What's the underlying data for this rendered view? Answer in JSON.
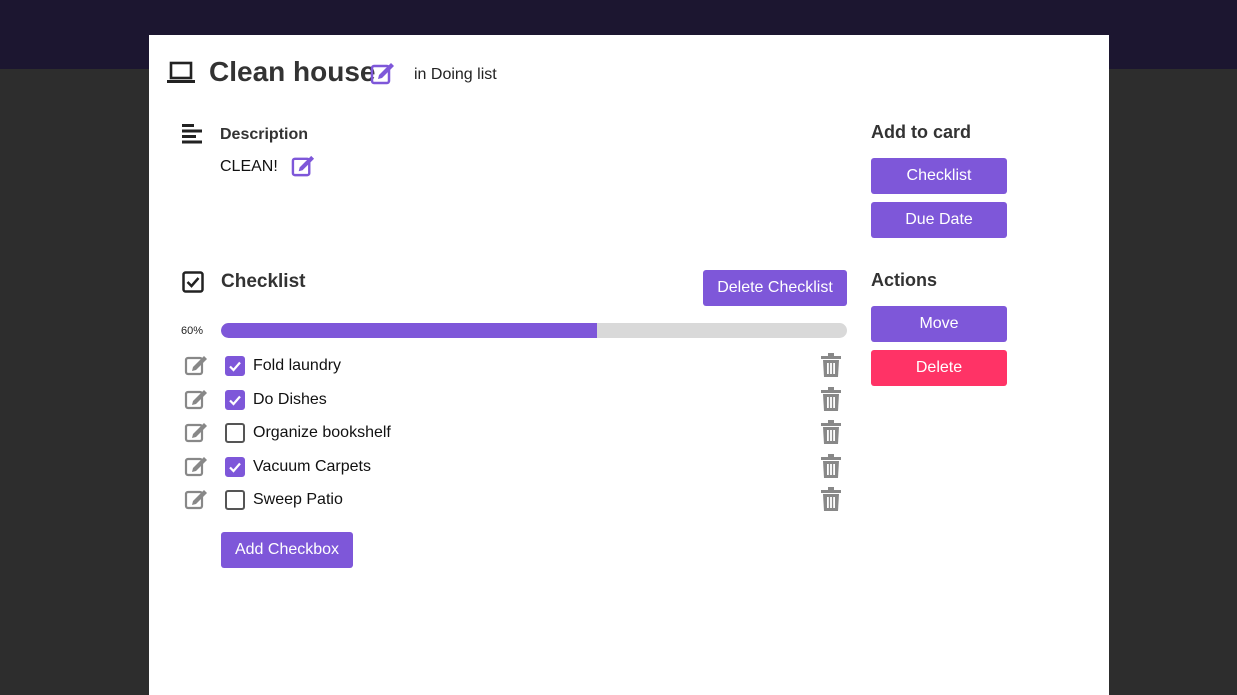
{
  "card": {
    "title": "Clean house",
    "list_label": "in Doing list"
  },
  "description": {
    "heading": "Description",
    "text": "CLEAN!"
  },
  "checklist": {
    "heading": "Checklist",
    "delete_label": "Delete Checklist",
    "progress_text": "60%",
    "progress": 0.6,
    "add_label": "Add Checkbox",
    "items": [
      {
        "label": "Fold laundry",
        "checked": true
      },
      {
        "label": "Do Dishes",
        "checked": true
      },
      {
        "label": "Organize bookshelf",
        "checked": false
      },
      {
        "label": "Vacuum Carpets",
        "checked": true
      },
      {
        "label": "Sweep Patio",
        "checked": false
      }
    ]
  },
  "sidebar": {
    "add_heading": "Add to card",
    "checklist_label": "Checklist",
    "due_date_label": "Due Date",
    "actions_heading": "Actions",
    "move_label": "Move",
    "delete_label": "Delete"
  },
  "colors": {
    "accent": "#7e57d9",
    "danger": "#ff3366",
    "topbar": "#1c1630",
    "backdrop": "#2d2d2d",
    "progress_track": "#d9d9d9"
  },
  "icons": {
    "card": "laptop-icon",
    "edit": "edit-icon",
    "description": "align-left-icon",
    "checklist": "check-square-icon",
    "trash": "trash-icon"
  }
}
